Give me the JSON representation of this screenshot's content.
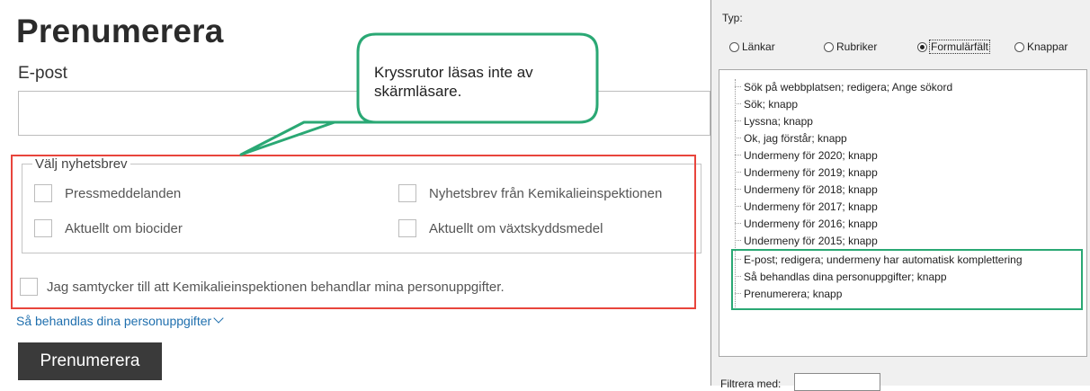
{
  "form": {
    "title": "Prenumerera",
    "email_label": "E-post",
    "email_value": "",
    "fieldset_legend": "Välj nyhetsbrev",
    "checkboxes": [
      {
        "label": "Pressmeddelanden",
        "checked": false
      },
      {
        "label": "Nyhetsbrev från Kemikalieinspektionen",
        "checked": false
      },
      {
        "label": "Aktuellt om biocider",
        "checked": false
      },
      {
        "label": "Aktuellt om växtskyddsmedel",
        "checked": false
      }
    ],
    "consent_label": "Jag samtycker till att Kemikalieinspektionen behandlar mina personuppgifter.",
    "privacy_link": "Så behandlas dina personuppgifter",
    "submit_label": "Prenumerera"
  },
  "annotation": {
    "bubble_text": "Kryssrutor läsas inte av skärmläsare.",
    "red_box_color": "#e8453c",
    "bubble_border_color": "#2aa874",
    "green_box_color": "#2aa874"
  },
  "panel": {
    "type_label": "Typ:",
    "radios": [
      {
        "label": "Länkar",
        "selected": false
      },
      {
        "label": "Rubriker",
        "selected": false
      },
      {
        "label": "Formulärfält",
        "selected": true
      },
      {
        "label": "Knappar",
        "selected": false
      }
    ],
    "items": [
      "Sök på webbplatsen; redigera; Ange sökord",
      "Sök; knapp",
      "Lyssna; knapp",
      "Ok, jag förstår; knapp",
      "Undermeny för 2020; knapp",
      "Undermeny för 2019; knapp",
      "Undermeny för 2018; knapp",
      "Undermeny för 2017; knapp",
      "Undermeny för 2016; knapp",
      "Undermeny för 2015; knapp",
      "E-post; redigera; undermeny har automatisk komplettering",
      "Så behandlas dina personuppgifter; knapp",
      "Prenumerera; knapp"
    ],
    "filter_label": "Filtrera med:",
    "filter_value": ""
  }
}
